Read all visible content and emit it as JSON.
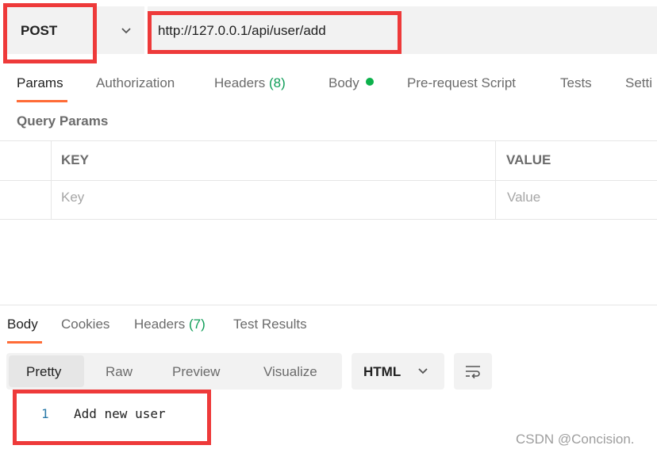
{
  "request": {
    "method": "POST",
    "url": "http://127.0.0.1/api/user/add"
  },
  "request_tabs": [
    {
      "label": "Params"
    },
    {
      "label": "Authorization"
    },
    {
      "label": "Headers",
      "count": "(8)"
    },
    {
      "label": "Body"
    },
    {
      "label": "Pre-request Script"
    },
    {
      "label": "Tests"
    },
    {
      "label": "Setti"
    }
  ],
  "query_params": {
    "title": "Query Params",
    "columns": [
      "KEY",
      "VALUE"
    ],
    "placeholders": [
      "Key",
      "Value"
    ]
  },
  "response_tabs": [
    {
      "label": "Body"
    },
    {
      "label": "Cookies"
    },
    {
      "label": "Headers",
      "count": "(7)"
    },
    {
      "label": "Test Results"
    }
  ],
  "view_modes": [
    "Pretty",
    "Raw",
    "Preview",
    "Visualize"
  ],
  "format": "HTML",
  "response_body": {
    "line_number": "1",
    "text": "Add new user"
  },
  "watermark": "CSDN @Concision.",
  "colors": {
    "accent": "#ff6c37",
    "highlight": "#ee3a3a",
    "count_green": "#0f9d58",
    "body_dot": "#0cb14b"
  },
  "icons": [
    "chevron-down-icon",
    "wrap-lines-icon"
  ]
}
